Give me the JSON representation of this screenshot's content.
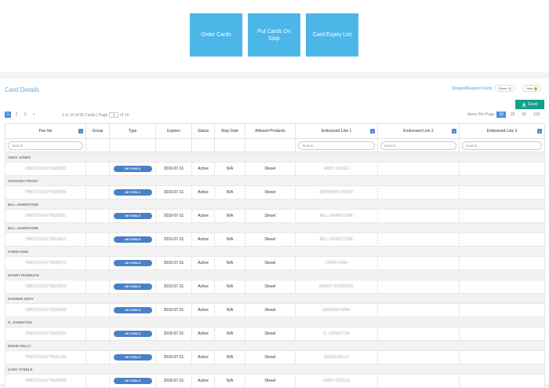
{
  "top_buttons": [
    {
      "label": "Order Cards"
    },
    {
      "label": "Put Cards On Stop"
    },
    {
      "label": "Card Expiry List"
    }
  ],
  "title": "Card Details",
  "stopped_label": "Stopped/Expired Cards",
  "toggles": [
    {
      "label": "Show",
      "dot_color": "#cccccc"
    },
    {
      "label": "Hide",
      "dot_color": "#8bc34a"
    }
  ],
  "excel_label": "Excel",
  "pagination": {
    "pages": [
      "1",
      "2",
      "3",
      "»"
    ],
    "info_prefix": "1 to 10 of 96 Cards | Page",
    "current_page": "1",
    "info_suffix": "of 10"
  },
  "items_per_page": {
    "label": "Items Per Page",
    "options": [
      "10",
      "25",
      "50",
      "100"
    ],
    "selected": "10"
  },
  "columns": [
    {
      "label": "Pan No",
      "sort": "↕"
    },
    {
      "label": "Group",
      "sort": ""
    },
    {
      "label": "Type",
      "sort": ""
    },
    {
      "label": "Expires",
      "sort": ""
    },
    {
      "label": "Status",
      "sort": ""
    },
    {
      "label": "Stop Date",
      "sort": ""
    },
    {
      "label": "Allowed Products",
      "sort": ""
    },
    {
      "label": "Embossed Line 1",
      "sort": "↕"
    },
    {
      "label": "Embossed Line 2",
      "sort": "↕"
    },
    {
      "label": "Embossed Line 3",
      "sort": "↕"
    }
  ],
  "search_placeholder": "Search...",
  "rows": [
    {
      "group": "ANDY JONES",
      "pan": "7896721014776625691",
      "type": "UK FUELS",
      "expires": "2018-07-31",
      "status": "Active",
      "stop": "N/A",
      "products": "Diesel",
      "line1": "ANDY JONES"
    },
    {
      "group": "ANTHONY FROST",
      "pan": "7896721014776625206",
      "type": "UK FUELS",
      "expires": "2019-07-31",
      "status": "Active",
      "stop": "N/A",
      "products": "Diesel",
      "line1": "ANTHONY FROST"
    },
    {
      "group": "BILL JOHNSTONE",
      "pan": "7896721014776625281",
      "type": "UK FUELS",
      "expires": "2018-07-31",
      "status": "Active",
      "stop": "N/A",
      "products": "Diesel",
      "line1": "BILL JOHNSTONE"
    },
    {
      "group": "BILL JOHNSTONE",
      "pan": "7896721014776624612",
      "type": "UK FUELS",
      "expires": "2019-07-31",
      "status": "Active",
      "stop": "N/A",
      "products": "Diesel",
      "line1": "BILL JOHNSTONE"
    },
    {
      "group": "CHRIS KING",
      "pan": "7896721014776625075",
      "type": "UK FUELS",
      "expires": "2018-07-31",
      "status": "Active",
      "stop": "N/A",
      "products": "Diesel",
      "line1": "CHRIS KING"
    },
    {
      "group": "DANNY RODBUCK",
      "pan": "7896721014776624670",
      "type": "UK FUELS",
      "expires": "2019-07-31",
      "status": "Active",
      "stop": "N/A",
      "products": "Diesel",
      "line1": "DANNY RODBUCK"
    },
    {
      "group": "DARREN GRAY",
      "pan": "7896721014776624696",
      "type": "UK FUELS",
      "expires": "2018-07-31",
      "status": "Active",
      "stop": "N/A",
      "products": "Diesel",
      "line1": "DARREN GRAY"
    },
    {
      "group": "D. JOHNSTON",
      "pan": "7896721014776625224",
      "type": "UK FUELS",
      "expires": "2018-07-31",
      "status": "Active",
      "stop": "N/A",
      "products": "Diesel",
      "line1": "D. JOHNSTON"
    },
    {
      "group": "EDDIE KELLY",
      "pan": "7896721014776625146",
      "type": "UK FUELS",
      "expires": "2018-07-31",
      "status": "Active",
      "stop": "N/A",
      "products": "Diesel",
      "line1": "EDDIE KELLY"
    },
    {
      "group": "GARY STEELE",
      "pan": "7896721014776625009",
      "type": "UK FUELS",
      "expires": "2018-07-31",
      "status": "Active",
      "stop": "N/A",
      "products": "Diesel",
      "line1": "GARY STEELE"
    }
  ]
}
